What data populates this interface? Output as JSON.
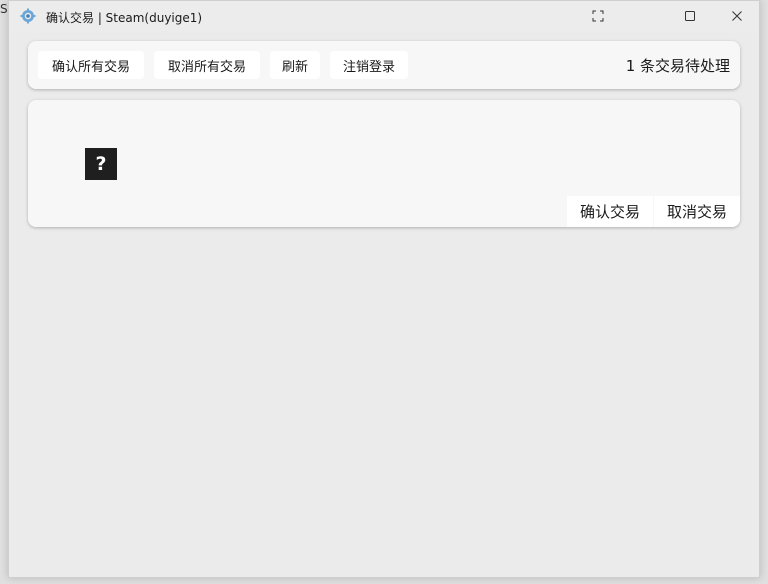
{
  "background": {
    "stub_text": "St"
  },
  "window": {
    "title": "确认交易 | Steam(duyige1)",
    "icons": {
      "app": "steam-gear-icon",
      "fullscreen": "fullscreen-icon",
      "maximize": "maximize-icon",
      "close": "close-icon"
    }
  },
  "toolbar": {
    "confirm_all_label": "确认所有交易",
    "cancel_all_label": "取消所有交易",
    "refresh_label": "刷新",
    "logout_label": "注销登录",
    "pending_text": "1 条交易待处理"
  },
  "trade_card": {
    "icon_glyph": "?",
    "confirm_label": "确认交易",
    "cancel_label": "取消交易"
  },
  "colors": {
    "window_bg": "#ebebeb",
    "panel_bg": "#f7f7f7",
    "button_bg": "#ffffff",
    "icon_bg": "#1f1f1f"
  }
}
